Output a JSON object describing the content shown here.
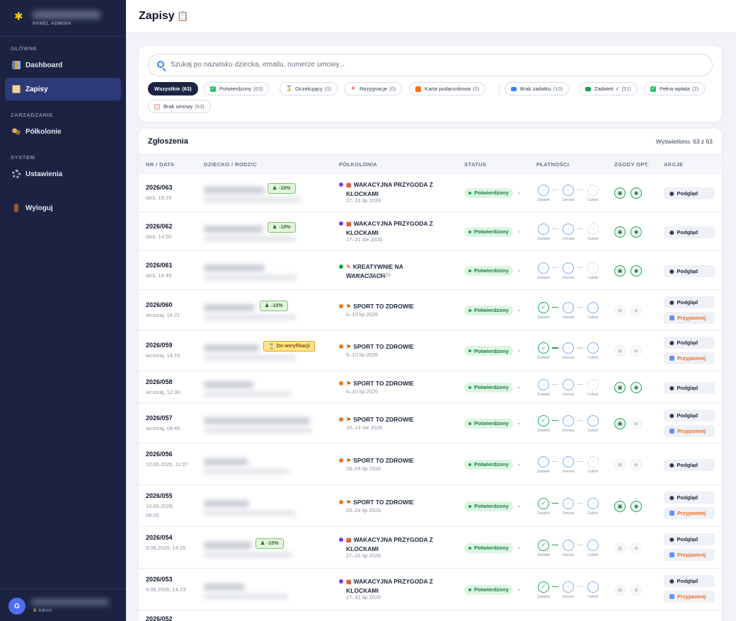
{
  "sidebar": {
    "logo_icon": "puzzle-kid-icon",
    "subtitle": "PANEL ADMINA",
    "sections": [
      {
        "label": "GŁÓWNE",
        "items": [
          {
            "label": "Dashboard",
            "icon": "chart-icon"
          },
          {
            "label": "Zapisy",
            "icon": "clipboard-icon",
            "active": true
          }
        ]
      },
      {
        "label": "ZARZĄDZANIE",
        "items": [
          {
            "label": "Półkolonie",
            "icon": "group-icon"
          }
        ]
      },
      {
        "label": "SYSTEM",
        "items": [
          {
            "label": "Ustawienia",
            "icon": "gear-icon"
          }
        ]
      }
    ],
    "logout": "Wyloguj",
    "user": {
      "initial": "G",
      "role": "Admin"
    }
  },
  "header": {
    "title": "Zapisy",
    "icon": "clipboard-icon"
  },
  "search": {
    "placeholder": "Szukaj po nazwisku dziecka, emailu, numerze umowy..."
  },
  "filters": [
    {
      "label": "Wszystkie",
      "count": "(63)",
      "active": true
    },
    {
      "label": "Potwierdzony",
      "count": "(63)",
      "icon": "check-box-icon"
    },
    {
      "label": "Oczekujący",
      "count": "(0)",
      "icon": "hourglass-icon"
    },
    {
      "label": "Rezygnacje",
      "count": "(0)",
      "icon": "cross-icon"
    },
    {
      "label": "Karta podarunkowa",
      "count": "(0)",
      "icon": "gift-icon"
    },
    {
      "label": "Brak zadatku",
      "count": "(10)",
      "icon": "card-icon"
    },
    {
      "label": "Zadatek ✓",
      "count": "(51)",
      "icon": "money-icon"
    },
    {
      "label": "Pełna wpłata",
      "count": "(2)",
      "icon": "check-box-icon"
    },
    {
      "label": "Brak umowy",
      "count": "(63)",
      "icon": "document-icon"
    }
  ],
  "table": {
    "title": "Zgłoszenia",
    "count_text": "Wyświetlono: 63 z 63",
    "columns": [
      "NR / DATA",
      "DZIECKO / RODZIC",
      "PÓŁKOLONIA",
      "STATUS",
      "PŁATNOŚCI",
      "ZGODY OPT.",
      "AKCJE"
    ],
    "payment_labels": [
      "Zadatek",
      "Umowa",
      "Całość"
    ],
    "view_label": "Podgląd",
    "remind_label": "Przypomnij",
    "rows": [
      {
        "nr": "2026/063",
        "date": "dziś, 15:19",
        "discount": "-10%",
        "program": "WAKACYJNA PRZYGODA Z KLOCKAMI",
        "program_color": "#7c3aed",
        "dates": "27–31 lip 2026",
        "status": "Potwierdzony",
        "deposit": "pending",
        "contract": "pending",
        "full": "na",
        "consents": true,
        "remind": false
      },
      {
        "nr": "2026/062",
        "date": "dziś, 14:50",
        "discount": "-10%",
        "program": "WAKACYJNA PRZYGODA Z KLOCKAMI",
        "program_color": "#7c3aed",
        "dates": "17–21 sie 2026",
        "status": "Potwierdzony",
        "deposit": "pending",
        "contract": "pending",
        "full": "na",
        "consents": true,
        "remind": false
      },
      {
        "nr": "2026/061",
        "date": "dziś, 14:49",
        "discount": "",
        "program": "KREATYWNIE NA WAKACJACH",
        "program_color": "#16a34a",
        "dates": "29 cze – 3 lip 2026",
        "status": "Potwierdzony",
        "deposit": "pending",
        "contract": "pending",
        "full": "na",
        "consents": true,
        "remind": false
      },
      {
        "nr": "2026/060",
        "date": "wczoraj, 14:21",
        "discount": "-10%",
        "program": "SPORT TO ZDROWIE",
        "program_color": "#f97316",
        "dates": "6–10 lip 2026",
        "status": "Potwierdzony",
        "deposit": "ok",
        "contract": "pending",
        "full": "pending",
        "consents": false,
        "remind": true
      },
      {
        "nr": "2026/059",
        "date": "wczoraj, 14:19",
        "discount": "Do weryfikacji",
        "program": "SPORT TO ZDROWIE",
        "program_color": "#f97316",
        "dates": "6–10 lip 2026",
        "status": "Potwierdzony",
        "deposit": "ok",
        "contract": "pending",
        "full": "pending",
        "consents": false,
        "remind": true
      },
      {
        "nr": "2026/058",
        "date": "wczoraj, 12:30",
        "discount": "",
        "program": "SPORT TO ZDROWIE",
        "program_color": "#f97316",
        "dates": "6–10 lip 2026",
        "status": "Potwierdzony",
        "deposit": "pending",
        "contract": "pending",
        "full": "na",
        "consents": true,
        "remind": false
      },
      {
        "nr": "2026/057",
        "date": "wczoraj, 08:45",
        "discount": "",
        "program": "SPORT TO ZDROWIE",
        "program_color": "#f97316",
        "dates": "10–14 sie 2026",
        "status": "Potwierdzony",
        "deposit": "ok",
        "contract": "pending",
        "full": "pending",
        "consents": "partial",
        "remind": true
      },
      {
        "nr": "2026/056",
        "date": "10.06.2026, 11:07",
        "discount": "",
        "program": "SPORT TO ZDROWIE",
        "program_color": "#f97316",
        "dates": "20–24 lip 2026",
        "status": "Potwierdzony",
        "deposit": "pending",
        "contract": "pending",
        "full": "na",
        "consents": false,
        "remind": false
      },
      {
        "nr": "2026/055",
        "date": "10.06.2026, 08:26",
        "discount": "",
        "program": "SPORT TO ZDROWIE",
        "program_color": "#f97316",
        "dates": "20–24 lip 2026",
        "status": "Potwierdzony",
        "deposit": "ok",
        "contract": "pending",
        "full": "pending",
        "consents": true,
        "remind": true
      },
      {
        "nr": "2026/054",
        "date": "9.06.2026, 14:25",
        "discount": "-10%",
        "program": "WAKACYJNA PRZYGODA Z KLOCKAMI",
        "program_color": "#7c3aed",
        "dates": "27–31 lip 2026",
        "status": "Potwierdzony",
        "deposit": "ok",
        "contract": "pending",
        "full": "pending",
        "consents": false,
        "remind": true
      },
      {
        "nr": "2026/053",
        "date": "9.06.2026, 14:23",
        "discount": "",
        "program": "WAKACYJNA PRZYGODA Z KLOCKAMI",
        "program_color": "#7c3aed",
        "dates": "27–31 lip 2026",
        "status": "Potwierdzony",
        "deposit": "ok",
        "contract": "pending",
        "full": "pending",
        "consents": false,
        "remind": true
      },
      {
        "nr": "2026/052",
        "date": "",
        "discount": "",
        "program": "",
        "program_color": "#7c3aed",
        "dates": "",
        "status": "",
        "deposit": "",
        "contract": "",
        "full": "",
        "consents": false,
        "remind": false
      }
    ]
  }
}
